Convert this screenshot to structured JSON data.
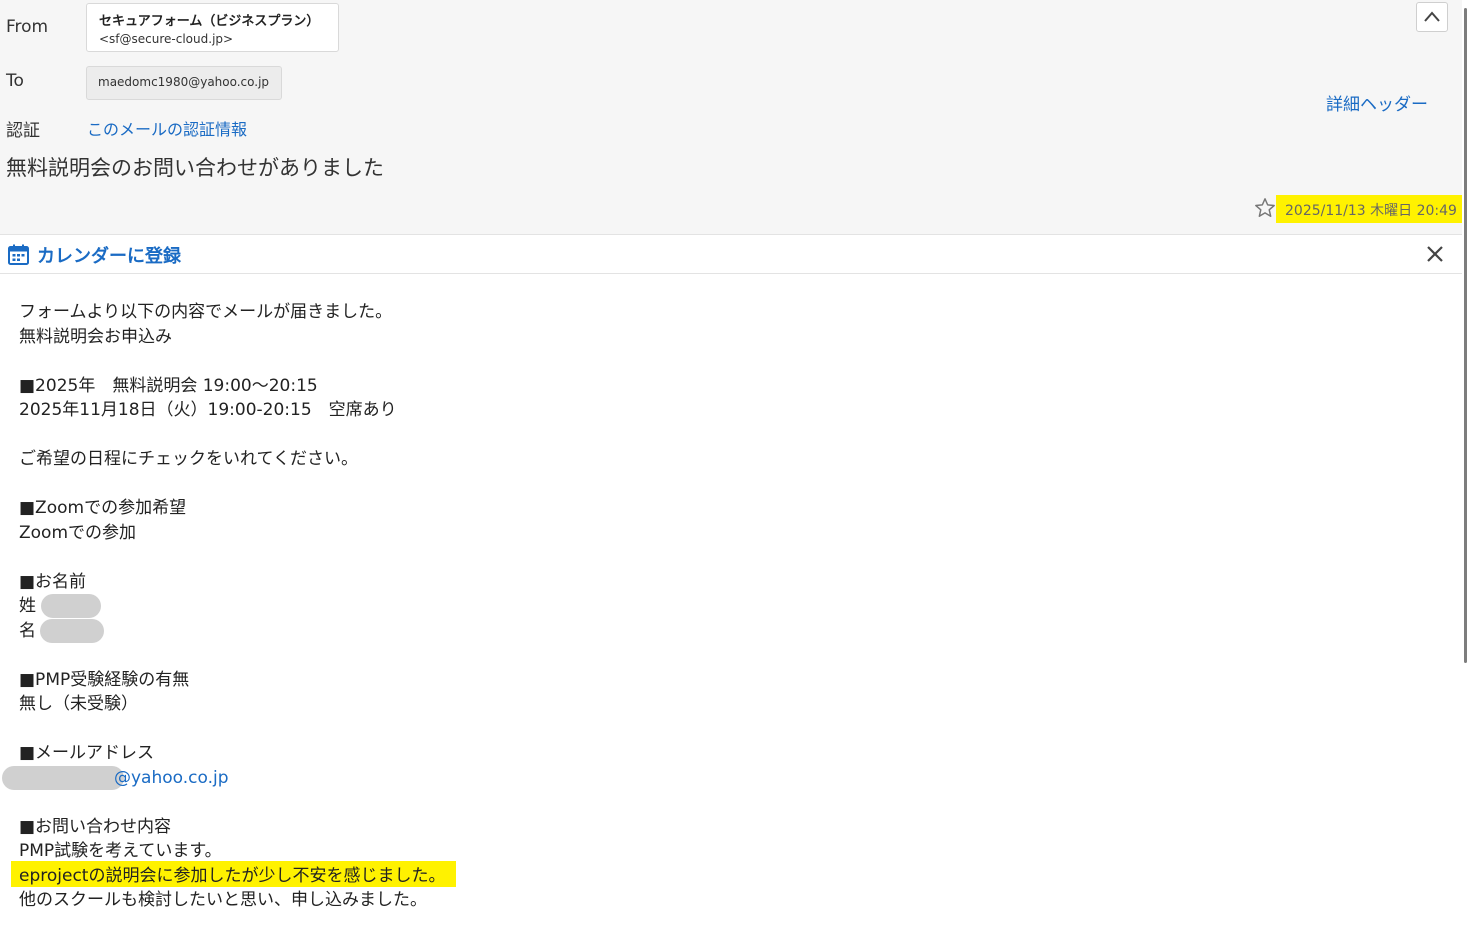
{
  "header": {
    "from_label": "From",
    "from_name": "セキュアフォーム（ビジネスプラン）",
    "from_address": "<sf@secure-cloud.jp>",
    "to_label": "To",
    "to_address": "maedomc1980@yahoo.co.jp",
    "auth_label": "認証",
    "auth_link": "このメールの認証情報",
    "detail_header_link": "詳細ヘッダー",
    "collapse_icon": "chevron-up-icon",
    "subject": "無料説明会のお問い合わせがありました",
    "star_icon": "star-outline-icon",
    "date": "2025/11/13 木曜日 20:49"
  },
  "calendar_bar": {
    "icon": "calendar-icon",
    "label": "カレンダーに登録",
    "close_icon": "close-icon"
  },
  "body": {
    "lines": [
      "フォームより以下の内容でメールが届きました。",
      "無料説明会お申込み",
      "",
      "■2025年　無料説明会 19:00～20:15",
      "2025年11月18日（火）19:00-20:15　空席あり",
      "",
      "ご希望の日程にチェックをいれてください。",
      "",
      "■Zoomでの参加希望",
      "Zoomでの参加",
      "",
      "■お名前",
      "姓 :",
      "名",
      "",
      "■PMP受験経験の有無",
      "無し（未受験）",
      "",
      "■メールアドレス"
    ],
    "email_suffix": "@yahoo.co.jp",
    "lines_after": [
      "",
      "■お問い合わせ内容",
      "PMP試験を考えています。",
      "eprojectの説明会に参加したが少し不安を感じました。",
      "他のスクールも検討したいと思い、申し込みました。"
    ]
  },
  "colors": {
    "link": "#1a6bc4",
    "highlight": "#fff200",
    "header_bg": "#f6f6f6"
  }
}
